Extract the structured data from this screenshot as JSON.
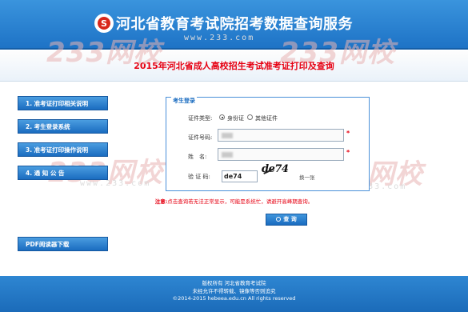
{
  "header": {
    "logo_glyph": "S",
    "title": "河北省教育考试院招考数据查询服务",
    "sub_title": "2015年河北省成人高校招生考试准考证打印及查询"
  },
  "watermark": {
    "text": "233网校",
    "url": "www.233.com"
  },
  "sidebar": {
    "items": [
      {
        "label": "1. 准考证打印相关说明"
      },
      {
        "label": "2. 考生登录系统"
      },
      {
        "label": "3. 准考证打印操作说明"
      },
      {
        "label": "4. 通 知 公 告"
      }
    ],
    "pdf_label": "PDF阅读器下载"
  },
  "login": {
    "legend": "考生登录",
    "cert_type_label": "证件类型:",
    "cert_options": [
      {
        "label": "身份证",
        "checked": true
      },
      {
        "label": "其他证件",
        "checked": false
      }
    ],
    "cert_no_label": "证件号码:",
    "name_label": "姓　名:",
    "captcha_label": "验 证 码:",
    "captcha_value": "de74",
    "captcha_image_text": "de74",
    "captcha_refresh": "换一张",
    "required_mark": "*"
  },
  "notice": {
    "prefix": "注意:",
    "text": "点击查询若无法正常显示，可能是系统忙，请避开高峰期查询。"
  },
  "query_button": {
    "label": "查 询"
  },
  "footer": {
    "lines": [
      "版权所有 河北省教育考试院",
      "未经允许不得转载、镜像等否则追究",
      "©2014-2015 hebeea.edu.cn All rights reserved"
    ]
  },
  "colors": {
    "header_blue": "#1e73c6",
    "title_red": "#e60012",
    "button_blue": "#1a6cc0"
  }
}
